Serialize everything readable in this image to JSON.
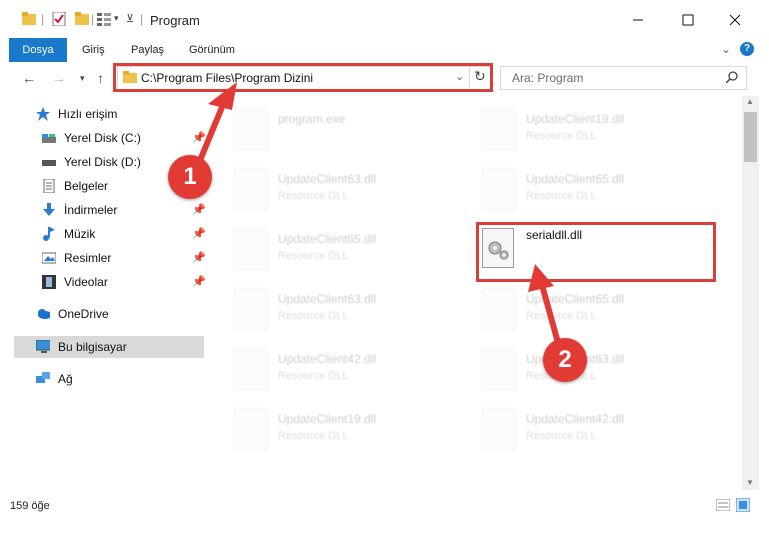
{
  "window": {
    "title": "Program"
  },
  "ribbon": {
    "tabs": [
      "Dosya",
      "Giriş",
      "Paylaş",
      "Görünüm"
    ]
  },
  "address": {
    "path": "C:\\Program Files\\Program Dizini"
  },
  "search": {
    "placeholder": "Ara: Program"
  },
  "sidebar": {
    "items": [
      {
        "label": "Hızlı erişim",
        "icon": "star-icon"
      },
      {
        "label": "Yerel Disk (C:)",
        "icon": "drive-icon"
      },
      {
        "label": "Yerel Disk (D:)",
        "icon": "drive-icon"
      },
      {
        "label": "Belgeler",
        "icon": "documents-icon"
      },
      {
        "label": "İndirmeler",
        "icon": "download-icon"
      },
      {
        "label": "Müzik",
        "icon": "music-icon"
      },
      {
        "label": "Resimler",
        "icon": "pictures-icon"
      },
      {
        "label": "Videolar",
        "icon": "videos-icon"
      },
      {
        "label": "OneDrive",
        "icon": "cloud-icon"
      },
      {
        "label": "Bu bilgisayar",
        "icon": "computer-icon"
      },
      {
        "label": "Ağ",
        "icon": "network-icon"
      }
    ]
  },
  "files": [
    {
      "name": "program.exe",
      "type": ""
    },
    {
      "name": "UpdateClient19.dll",
      "type": "Resource DLL"
    },
    {
      "name": "UpdateClient63.dll",
      "type": "Resource DLL"
    },
    {
      "name": "UpdateClient65.dll",
      "type": "Resource DLL"
    },
    {
      "name": "UpdateClient65.dll",
      "type": "Resource DLL"
    },
    {
      "name": "serialdll.dll",
      "type": ""
    },
    {
      "name": "UpdateClient63.dll",
      "type": "Resource DLL"
    },
    {
      "name": "UpdateClient65.dll",
      "type": "Resource DLL"
    },
    {
      "name": "UpdateClient42.dll",
      "type": "Resource DLL"
    },
    {
      "name": "UpdateClient63.dll",
      "type": "Resource DLL"
    },
    {
      "name": "UpdateClient19.dll",
      "type": "Resource DLL"
    },
    {
      "name": "UpdateClient42.dll",
      "type": "Resource DLL"
    }
  ],
  "status": {
    "count": "159 öğe"
  },
  "annotations": {
    "badge1": "1",
    "badge2": "2",
    "color": "#e23a34"
  }
}
